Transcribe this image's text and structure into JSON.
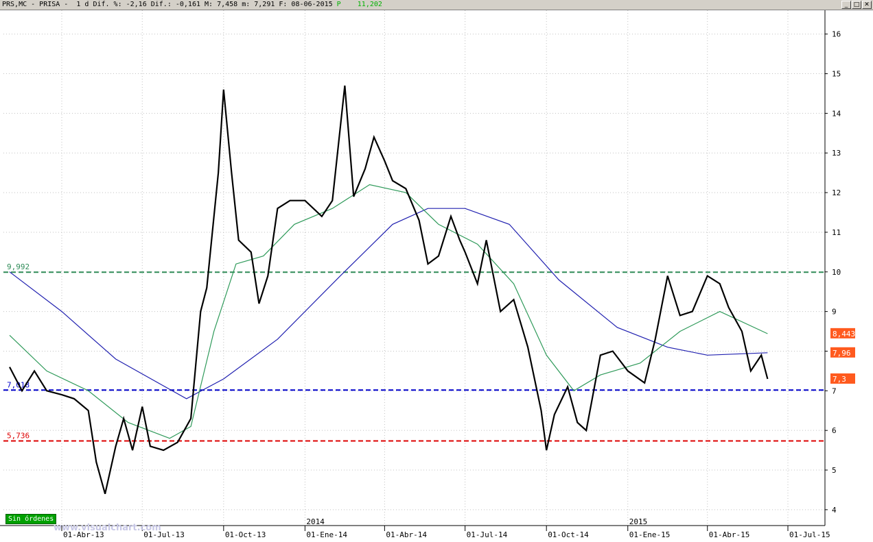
{
  "window": {
    "title": "PRS,MC - PRISA -  1 d Dif. %: -2,16 Dif.: -0,161 M: 7,458 m: 7,291 F: 08-06-2015",
    "title_p": "P    11,202",
    "buttons": {
      "minimize": "_",
      "maximize": "□",
      "close": "✕"
    }
  },
  "status": {
    "orders_label": "Sin órdenes",
    "watermark": "www.visualchart.com"
  },
  "price_tags": {
    "ma50": "8,443",
    "ma200": "7,96",
    "last": "7,3"
  },
  "levels": {
    "resistance": "9,992",
    "support": "7,018",
    "low": "5,736"
  },
  "colors": {
    "price": "#000000",
    "ma_green": "#2f9a5a",
    "ma_blue": "#2020b0",
    "level_green": "#2e8b57",
    "level_blue": "#0000cc",
    "level_red": "#dd0000",
    "tag_bg": "#ff5a1e",
    "grid": "#c0c0c0"
  },
  "chart_data": {
    "type": "candlestick-line",
    "symbol": "PRS,MC",
    "name": "PRISA",
    "y_ticks": [
      4,
      5,
      6,
      7,
      8,
      9,
      10,
      11,
      12,
      13,
      14,
      15,
      16
    ],
    "ylim": [
      3.6,
      16.6
    ],
    "x_ticks": [
      {
        "label": "01-Abr-13",
        "date": "2013-04-01"
      },
      {
        "label": "01-Jul-13",
        "date": "2013-07-01"
      },
      {
        "label": "01-Oct-13",
        "date": "2013-10-01"
      },
      {
        "label": "01-Ene-14",
        "date": "2014-01-01",
        "year": "2014"
      },
      {
        "label": "01-Abr-14",
        "date": "2014-04-01"
      },
      {
        "label": "01-Jul-14",
        "date": "2014-07-01"
      },
      {
        "label": "01-Oct-14",
        "date": "2014-10-01"
      },
      {
        "label": "01-Ene-15",
        "date": "2015-01-01",
        "year": "2015"
      },
      {
        "label": "01-Abr-15",
        "date": "2015-04-01"
      },
      {
        "label": "01-Jul-15",
        "date": "2015-07-01"
      }
    ],
    "horizontal_levels": [
      {
        "value": 9.992,
        "label": "9,992",
        "color": "level_green"
      },
      {
        "value": 7.018,
        "label": "7,018",
        "color": "level_blue"
      },
      {
        "value": 5.736,
        "label": "5,736",
        "color": "level_red"
      }
    ],
    "price": [
      [
        "2013-02-01",
        7.6
      ],
      [
        "2013-02-15",
        7.0
      ],
      [
        "2013-03-01",
        7.5
      ],
      [
        "2013-03-15",
        7.0
      ],
      [
        "2013-04-01",
        6.9
      ],
      [
        "2013-04-15",
        6.8
      ],
      [
        "2013-05-01",
        6.5
      ],
      [
        "2013-05-10",
        5.2
      ],
      [
        "2013-05-20",
        4.4
      ],
      [
        "2013-06-01",
        5.6
      ],
      [
        "2013-06-10",
        6.3
      ],
      [
        "2013-06-20",
        5.5
      ],
      [
        "2013-07-01",
        6.6
      ],
      [
        "2013-07-10",
        5.6
      ],
      [
        "2013-07-25",
        5.5
      ],
      [
        "2013-08-10",
        5.7
      ],
      [
        "2013-08-25",
        6.3
      ],
      [
        "2013-09-05",
        9.0
      ],
      [
        "2013-09-12",
        9.6
      ],
      [
        "2013-09-25",
        12.5
      ],
      [
        "2013-10-01",
        14.6
      ],
      [
        "2013-10-10",
        12.5
      ],
      [
        "2013-10-18",
        10.8
      ],
      [
        "2013-11-01",
        10.5
      ],
      [
        "2013-11-10",
        9.2
      ],
      [
        "2013-11-20",
        9.9
      ],
      [
        "2013-12-01",
        11.6
      ],
      [
        "2013-12-15",
        11.8
      ],
      [
        "2014-01-01",
        11.8
      ],
      [
        "2014-01-20",
        11.4
      ],
      [
        "2014-02-01",
        11.8
      ],
      [
        "2014-02-15",
        14.7
      ],
      [
        "2014-02-25",
        11.9
      ],
      [
        "2014-03-10",
        12.6
      ],
      [
        "2014-03-20",
        13.4
      ],
      [
        "2014-04-01",
        12.8
      ],
      [
        "2014-04-10",
        12.3
      ],
      [
        "2014-04-25",
        12.1
      ],
      [
        "2014-05-10",
        11.3
      ],
      [
        "2014-05-20",
        10.2
      ],
      [
        "2014-06-01",
        10.4
      ],
      [
        "2014-06-15",
        11.4
      ],
      [
        "2014-06-25",
        10.8
      ],
      [
        "2014-07-01",
        10.5
      ],
      [
        "2014-07-15",
        9.7
      ],
      [
        "2014-07-25",
        10.8
      ],
      [
        "2014-08-10",
        9.0
      ],
      [
        "2014-08-25",
        9.3
      ],
      [
        "2014-09-10",
        8.1
      ],
      [
        "2014-09-25",
        6.5
      ],
      [
        "2014-10-01",
        5.5
      ],
      [
        "2014-10-10",
        6.4
      ],
      [
        "2014-10-25",
        7.1
      ],
      [
        "2014-11-05",
        6.2
      ],
      [
        "2014-11-15",
        6.0
      ],
      [
        "2014-12-01",
        7.9
      ],
      [
        "2014-12-15",
        8.0
      ],
      [
        "2015-01-01",
        7.5
      ],
      [
        "2015-01-20",
        7.2
      ],
      [
        "2015-02-01",
        8.3
      ],
      [
        "2015-02-15",
        9.9
      ],
      [
        "2015-03-01",
        8.9
      ],
      [
        "2015-03-15",
        9.0
      ],
      [
        "2015-04-01",
        9.9
      ],
      [
        "2015-04-15",
        9.7
      ],
      [
        "2015-04-25",
        9.1
      ],
      [
        "2015-05-10",
        8.5
      ],
      [
        "2015-05-20",
        7.5
      ],
      [
        "2015-06-01",
        7.9
      ],
      [
        "2015-06-08",
        7.3
      ]
    ],
    "ma_green": [
      [
        "2013-02-01",
        8.4
      ],
      [
        "2013-03-15",
        7.5
      ],
      [
        "2013-05-01",
        7.0
      ],
      [
        "2013-06-15",
        6.2
      ],
      [
        "2013-08-01",
        5.8
      ],
      [
        "2013-08-25",
        6.1
      ],
      [
        "2013-09-20",
        8.5
      ],
      [
        "2013-10-15",
        10.2
      ],
      [
        "2013-11-15",
        10.4
      ],
      [
        "2013-12-20",
        11.2
      ],
      [
        "2014-02-01",
        11.6
      ],
      [
        "2014-03-15",
        12.2
      ],
      [
        "2014-04-25",
        12.0
      ],
      [
        "2014-06-01",
        11.2
      ],
      [
        "2014-07-15",
        10.7
      ],
      [
        "2014-08-25",
        9.7
      ],
      [
        "2014-10-01",
        7.9
      ],
      [
        "2014-11-01",
        7.0
      ],
      [
        "2014-12-01",
        7.4
      ],
      [
        "2015-01-15",
        7.7
      ],
      [
        "2015-03-01",
        8.5
      ],
      [
        "2015-04-15",
        9.0
      ],
      [
        "2015-06-08",
        8.44
      ]
    ],
    "ma_blue": [
      [
        "2013-02-01",
        10.0
      ],
      [
        "2013-04-01",
        9.0
      ],
      [
        "2013-06-01",
        7.8
      ],
      [
        "2013-08-20",
        6.8
      ],
      [
        "2013-10-01",
        7.3
      ],
      [
        "2013-12-01",
        8.3
      ],
      [
        "2014-02-10",
        9.9
      ],
      [
        "2014-04-10",
        11.2
      ],
      [
        "2014-05-20",
        11.6
      ],
      [
        "2014-07-01",
        11.6
      ],
      [
        "2014-08-20",
        11.2
      ],
      [
        "2014-10-15",
        9.8
      ],
      [
        "2014-12-20",
        8.6
      ],
      [
        "2015-02-15",
        8.1
      ],
      [
        "2015-04-01",
        7.9
      ],
      [
        "2015-06-08",
        7.96
      ]
    ]
  }
}
